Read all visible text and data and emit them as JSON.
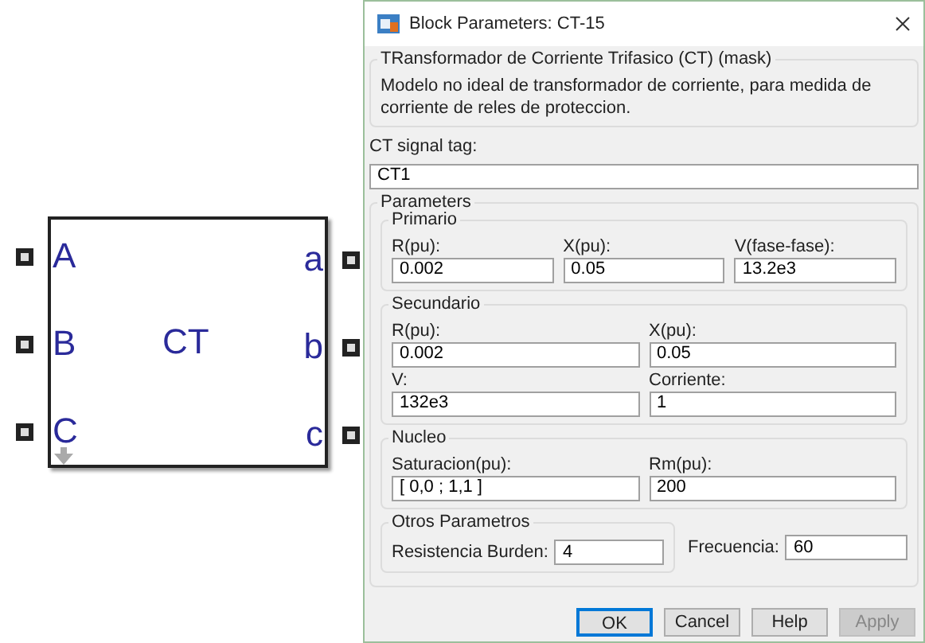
{
  "block": {
    "name": "CT",
    "inputs": [
      "A",
      "B",
      "C"
    ],
    "outputs": [
      "a",
      "b",
      "c"
    ]
  },
  "dialog": {
    "title": "Block Parameters: CT-15",
    "mask": {
      "title": "TRansformador de Corriente Trifasico (CT) (mask)",
      "description": "Modelo no ideal de transformador de corriente, para medida de corriente de reles de proteccion."
    },
    "signal_tag": {
      "label": "CT signal tag:",
      "value": "CT1"
    },
    "parameters": {
      "title": "Parameters",
      "groups": [
        {
          "title": "Primario",
          "fields": [
            {
              "label": "R(pu):",
              "value": "0.002"
            },
            {
              "label": "X(pu):",
              "value": "0.05"
            },
            {
              "label": "V(fase-fase):",
              "value": "13.2e3"
            }
          ]
        },
        {
          "title": "Secundario",
          "fields": [
            {
              "label": "R(pu):",
              "value": "0.002"
            },
            {
              "label": "X(pu):",
              "value": "0.05"
            },
            {
              "label": "V:",
              "value": "132e3"
            },
            {
              "label": "Corriente:",
              "value": "1"
            }
          ]
        },
        {
          "title": "Nucleo",
          "fields": [
            {
              "label": "Saturacion(pu):",
              "value": "[ 0,0 ; 1,1 ]"
            },
            {
              "label": "Rm(pu):",
              "value": "200"
            }
          ]
        }
      ],
      "others": {
        "title": "Otros Parametros",
        "fields": [
          {
            "label": "Resistencia Burden:",
            "value": "4"
          }
        ]
      },
      "frequency": {
        "label": "Frecuencia:",
        "value": "60"
      }
    },
    "buttons": [
      {
        "label": "OK",
        "default": true,
        "disabled": false
      },
      {
        "label": "Cancel",
        "default": false,
        "disabled": false
      },
      {
        "label": "Help",
        "default": false,
        "disabled": false
      },
      {
        "label": "Apply",
        "default": false,
        "disabled": true
      }
    ]
  }
}
